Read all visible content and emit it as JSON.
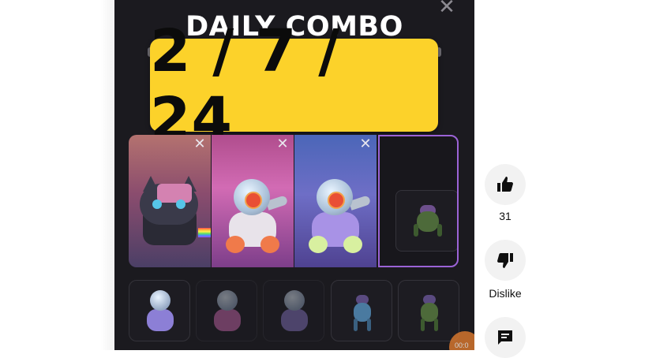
{
  "video": {
    "title": "DAILY COMBO",
    "date": "2 / 7 / 24",
    "close_glyph": "✕",
    "card_close_glyph": "✕",
    "timer_text": "00:0",
    "banner_color": "#fcd22a",
    "selected_border_color": "#9b63d6"
  },
  "combo_cards": [
    {
      "name": "cat-card"
    },
    {
      "name": "pink-robot-card"
    },
    {
      "name": "purple-robot-card"
    },
    {
      "name": "empty-slot-card"
    }
  ],
  "options": [
    {
      "name": "robot-option"
    },
    {
      "name": "pink-robot-option"
    },
    {
      "name": "purple-robot-option"
    },
    {
      "name": "blue-bug-option"
    },
    {
      "name": "green-bug-option"
    }
  ],
  "actions": {
    "like_count": "31",
    "dislike_label": "Dislike",
    "like_icon": "thumbs-up-icon",
    "dislike_icon": "thumbs-down-icon",
    "comment_icon": "comment-icon"
  }
}
